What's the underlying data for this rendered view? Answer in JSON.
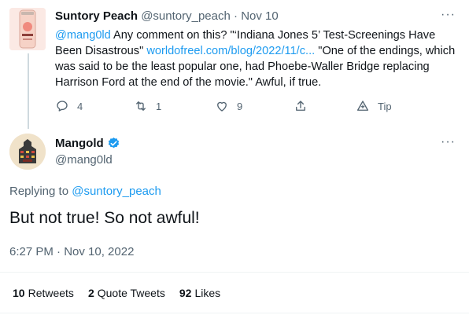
{
  "parent_tweet": {
    "author_name": "Suntory Peach",
    "author_handle": "@suntory_peach",
    "separator": "·",
    "date": "Nov 10",
    "mention": "@mang0ld",
    "text_before_link": " Any comment on this? \"‘Indiana Jones 5’ Test-Screenings Have Been Disastrous\" ",
    "link": "worldofreel.com/blog/2022/11/c...",
    "text_after_link": " \"One of the endings, which was said to be the least popular one, had Phoebe-Waller Bridge replacing Harrison Ford at the end of the movie.\" Awful, if true.",
    "reply_count": "4",
    "retweet_count": "1",
    "like_count": "9",
    "tip_label": "Tip",
    "more_icon": "more-dots-icon"
  },
  "main_tweet": {
    "author_name": "Mangold",
    "author_handle": "@mang0ld",
    "verified_icon": "verified-badge-icon",
    "replying_label": "Replying to",
    "replying_to": "@suntory_peach",
    "text": "But not true! So not awful!",
    "timestamp": "6:27 PM · Nov 10, 2022",
    "more_icon": "more-dots-icon"
  },
  "stats": {
    "retweets_count": "10",
    "retweets_label": "Retweets",
    "quotes_count": "2",
    "quotes_label": "Quote Tweets",
    "likes_count": "92",
    "likes_label": "Likes"
  },
  "colors": {
    "accent": "#1d9bf0",
    "muted": "#536471",
    "text": "#0f1419",
    "divider": "#eff3f4"
  }
}
